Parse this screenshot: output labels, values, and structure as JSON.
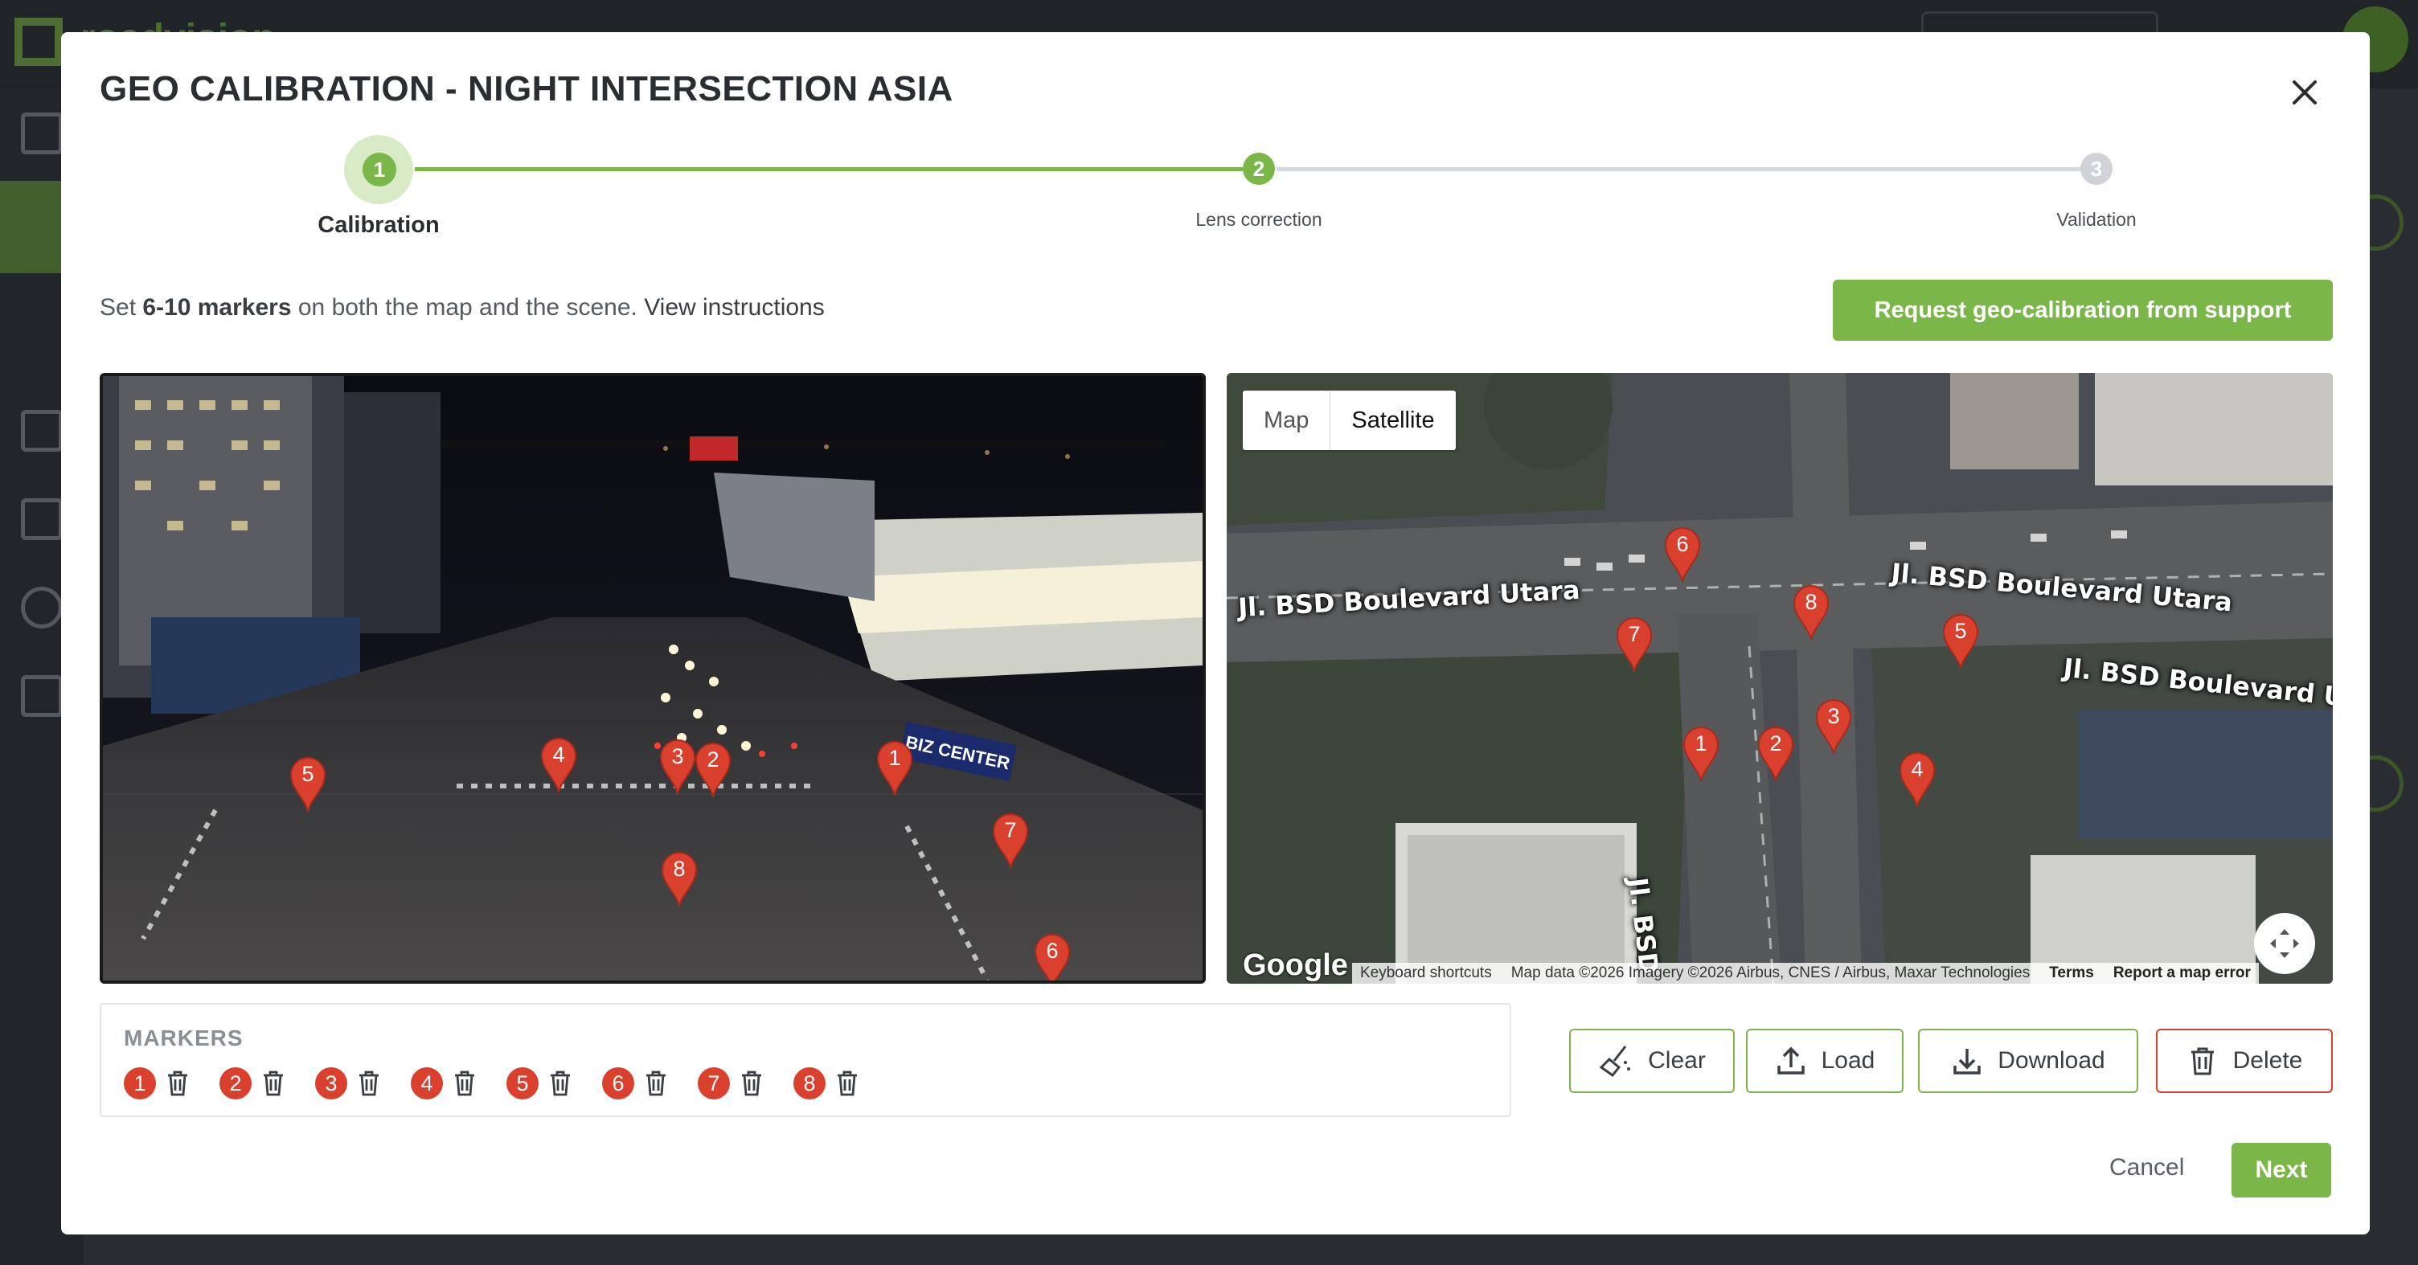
{
  "background": {
    "logo_text": "roadvision"
  },
  "dialog": {
    "title": "GEO CALIBRATION - NIGHT INTERSECTION ASIA",
    "close_label": "×"
  },
  "stepper": {
    "steps": [
      {
        "number": "1",
        "label": "Calibration",
        "state": "active"
      },
      {
        "number": "2",
        "label": "Lens correction",
        "state": "done"
      },
      {
        "number": "3",
        "label": "Validation",
        "state": "pending"
      }
    ]
  },
  "instructions": {
    "prefix": "Set ",
    "bold": "6-10 markers",
    "middle": " on both the map and the scene. ",
    "link": "View instructions"
  },
  "support_button": "Request geo-calibration from support",
  "scene": {
    "sign_text": "BIZ CENTER",
    "markers": [
      "1",
      "2",
      "3",
      "4",
      "5",
      "6",
      "7",
      "8"
    ]
  },
  "map": {
    "toggle": {
      "map": "Map",
      "satellite": "Satellite",
      "selected": "Satellite"
    },
    "road_labels": [
      "Jl. BSD Boulevard Utara",
      "Jl. BSD Boulevard Utara",
      "Jl. BSD Boulevard Uta",
      "Jl. BSD Raya Utama"
    ],
    "markers": [
      "1",
      "2",
      "3",
      "4",
      "5",
      "6",
      "7",
      "8"
    ],
    "google": "Google",
    "attribution": {
      "shortcuts": "Keyboard shortcuts",
      "data": "Map data ©2026 Imagery ©2026 Airbus, CNES / Airbus, Maxar Technologies",
      "terms": "Terms",
      "report": "Report a map error"
    }
  },
  "markers_panel": {
    "title": "MARKERS",
    "items": [
      "1",
      "2",
      "3",
      "4",
      "5",
      "6",
      "7",
      "8"
    ]
  },
  "actions": {
    "clear": "Clear",
    "load": "Load",
    "download": "Download",
    "delete": "Delete"
  },
  "footer": {
    "cancel": "Cancel",
    "next": "Next"
  },
  "colors": {
    "accent": "#7ab648",
    "marker": "#d9402d",
    "pending": "#cfd2d6"
  }
}
